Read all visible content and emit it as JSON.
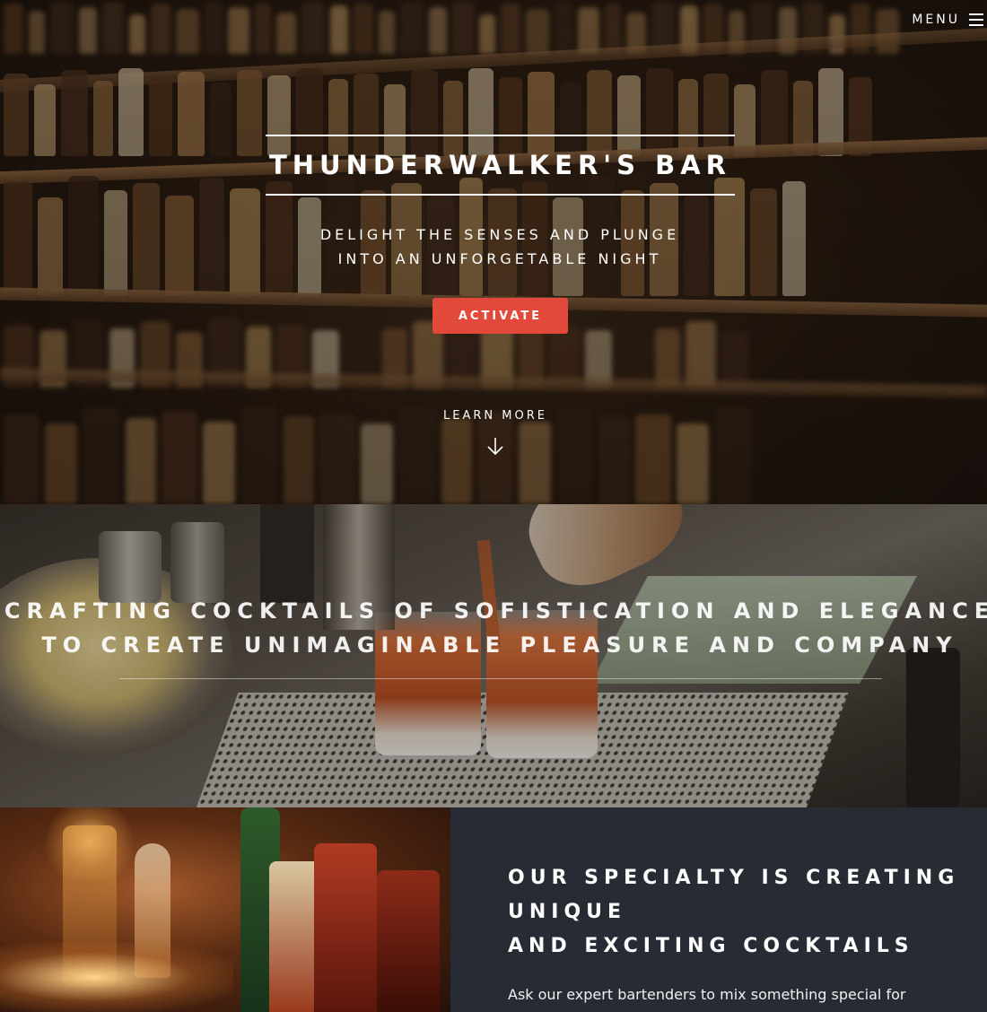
{
  "nav": {
    "menu_label": "MENU"
  },
  "hero": {
    "title": "THUNDERWALKER'S BAR",
    "subtitle_line1": "DELIGHT THE SENSES AND PLUNGE",
    "subtitle_line2": "INTO AN UNFORGETABLE NIGHT",
    "cta_label": "ACTIVATE",
    "learn_more": "LEARN MORE"
  },
  "crafting": {
    "line1": "CRAFTING COCKTAILS OF SOFISTICATION AND ELEGANCE",
    "line2": "TO CREATE UNIMAGINABLE PLEASURE AND COMPANY"
  },
  "specialty": {
    "heading_line1": "OUR SPECIALTY IS CREATING",
    "heading_line2": "UNIQUE",
    "heading_line3": "AND EXCITING COCKTAILS",
    "body": "Ask our expert bartenders to mix something special for"
  },
  "colors": {
    "accent": "#e2493a",
    "panel": "#262b34"
  }
}
